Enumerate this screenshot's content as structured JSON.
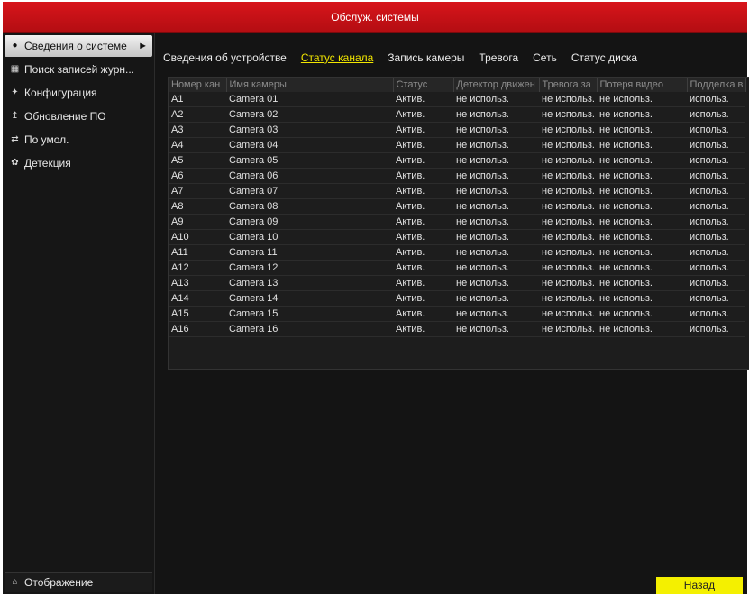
{
  "window": {
    "title": "Обслуж. системы"
  },
  "sidebar": {
    "items": [
      {
        "label": "Сведения о системе",
        "icon": "info-icon",
        "active": true
      },
      {
        "label": "Поиск записей журн...",
        "icon": "log-search-icon",
        "active": false
      },
      {
        "label": "Конфигурация",
        "icon": "config-icon",
        "active": false
      },
      {
        "label": "Обновление ПО",
        "icon": "upgrade-icon",
        "active": false
      },
      {
        "label": "По умол.",
        "icon": "default-icon",
        "active": false
      },
      {
        "label": "Детекция",
        "icon": "detection-icon",
        "active": false
      }
    ],
    "bottom_label": "Отображение"
  },
  "tabs": [
    {
      "label": "Сведения об устройстве",
      "active": false
    },
    {
      "label": "Статус канала",
      "active": true
    },
    {
      "label": "Запись камеры",
      "active": false
    },
    {
      "label": "Тревога",
      "active": false
    },
    {
      "label": "Сеть",
      "active": false
    },
    {
      "label": "Статус диска",
      "active": false
    }
  ],
  "table": {
    "headers": [
      "Номер кан",
      "Имя камеры",
      "Статус",
      "Детектор движен",
      "Тревога за",
      "Потеря видео",
      "Подделка в"
    ],
    "rows": [
      [
        "A1",
        "Camera 01",
        "Актив.",
        "не использ.",
        "не использ.",
        "не использ.",
        "использ."
      ],
      [
        "A2",
        "Camera 02",
        "Актив.",
        "не использ.",
        "не использ.",
        "не использ.",
        "использ."
      ],
      [
        "A3",
        "Camera 03",
        "Актив.",
        "не использ.",
        "не использ.",
        "не использ.",
        "использ."
      ],
      [
        "A4",
        "Camera 04",
        "Актив.",
        "не использ.",
        "не использ.",
        "не использ.",
        "использ."
      ],
      [
        "A5",
        "Camera 05",
        "Актив.",
        "не использ.",
        "не использ.",
        "не использ.",
        "использ."
      ],
      [
        "A6",
        "Camera 06",
        "Актив.",
        "не использ.",
        "не использ.",
        "не использ.",
        "использ."
      ],
      [
        "A7",
        "Camera 07",
        "Актив.",
        "не использ.",
        "не использ.",
        "не использ.",
        "использ."
      ],
      [
        "A8",
        "Camera 08",
        "Актив.",
        "не использ.",
        "не использ.",
        "не использ.",
        "использ."
      ],
      [
        "A9",
        "Camera 09",
        "Актив.",
        "не использ.",
        "не использ.",
        "не использ.",
        "использ."
      ],
      [
        "A10",
        "Camera 10",
        "Актив.",
        "не использ.",
        "не использ.",
        "не использ.",
        "использ."
      ],
      [
        "A11",
        "Camera 11",
        "Актив.",
        "не использ.",
        "не использ.",
        "не использ.",
        "использ."
      ],
      [
        "A12",
        "Camera 12",
        "Актив.",
        "не использ.",
        "не использ.",
        "не использ.",
        "использ."
      ],
      [
        "A13",
        "Camera 13",
        "Актив.",
        "не использ.",
        "не использ.",
        "не использ.",
        "использ."
      ],
      [
        "A14",
        "Camera 14",
        "Актив.",
        "не использ.",
        "не использ.",
        "не использ.",
        "использ."
      ],
      [
        "A15",
        "Camera 15",
        "Актив.",
        "не использ.",
        "не использ.",
        "не использ.",
        "использ."
      ],
      [
        "A16",
        "Camera 16",
        "Актив.",
        "не использ.",
        "не использ.",
        "не использ.",
        "использ."
      ]
    ]
  },
  "footer": {
    "back_label": "Назад"
  },
  "colors": {
    "title_bar": "#c8101a",
    "active_tab": "#f2e600",
    "back_button": "#f4f000"
  }
}
